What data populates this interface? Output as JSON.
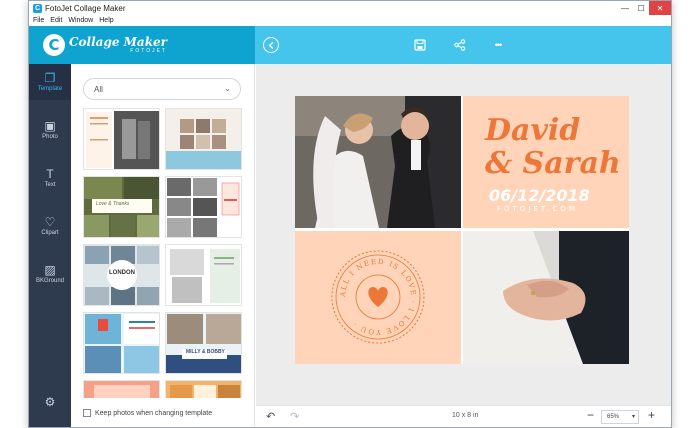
{
  "window": {
    "title": "FotoJet Collage Maker",
    "app_icon": "C",
    "controls": {
      "minimize": "—",
      "maximize": "☐",
      "close": "✕"
    }
  },
  "menu": [
    "File",
    "Edit",
    "Window",
    "Help"
  ],
  "brand": {
    "logo_letter": "C",
    "title": "Collage Maker",
    "subtitle": "FOTOJET"
  },
  "toolbar": {
    "back_icon": "back-arrow-icon",
    "save_icon": "save-icon",
    "share_icon": "share-icon",
    "more_icon": "more-icon",
    "more_label": "•••"
  },
  "sidebar": [
    {
      "label": "Template",
      "icon": "template-icon",
      "glyph": "❐",
      "active": true
    },
    {
      "label": "Photo",
      "icon": "photo-icon",
      "glyph": "▣",
      "active": false
    },
    {
      "label": "Text",
      "icon": "text-icon",
      "glyph": "T",
      "active": false
    },
    {
      "label": "Clipart",
      "icon": "heart-icon",
      "glyph": "♡",
      "active": false
    },
    {
      "label": "BKGround",
      "icon": "background-icon",
      "glyph": "▨",
      "active": false
    },
    {
      "label": "",
      "icon": "settings-icon",
      "glyph": "⚙",
      "active": false
    }
  ],
  "panel": {
    "filter_value": "All",
    "keep_photos_label": "Keep photos when changing template",
    "thumb_captions": [
      "Love & Thanks",
      "LONDON",
      "MILLY & BOBBY"
    ]
  },
  "collage": {
    "name_line1": "David",
    "name_line2": "& Sarah",
    "date": "06/12/2018",
    "watermark": "FOTOJET.COM",
    "badge_text": "ALL I NEED IS LOVE · I LOVE YOU ·"
  },
  "bottombar": {
    "undo": "↶",
    "redo": "↷",
    "size": "10 x 8 in",
    "zoom": "65%",
    "minus": "−",
    "plus": "+"
  },
  "colors": {
    "brand": "#0ea4cf",
    "toolbar": "#46c5ec",
    "sidebar": "#2e3a4e",
    "accent_orange": "#ec7738",
    "peach": "#ffd4b8"
  }
}
